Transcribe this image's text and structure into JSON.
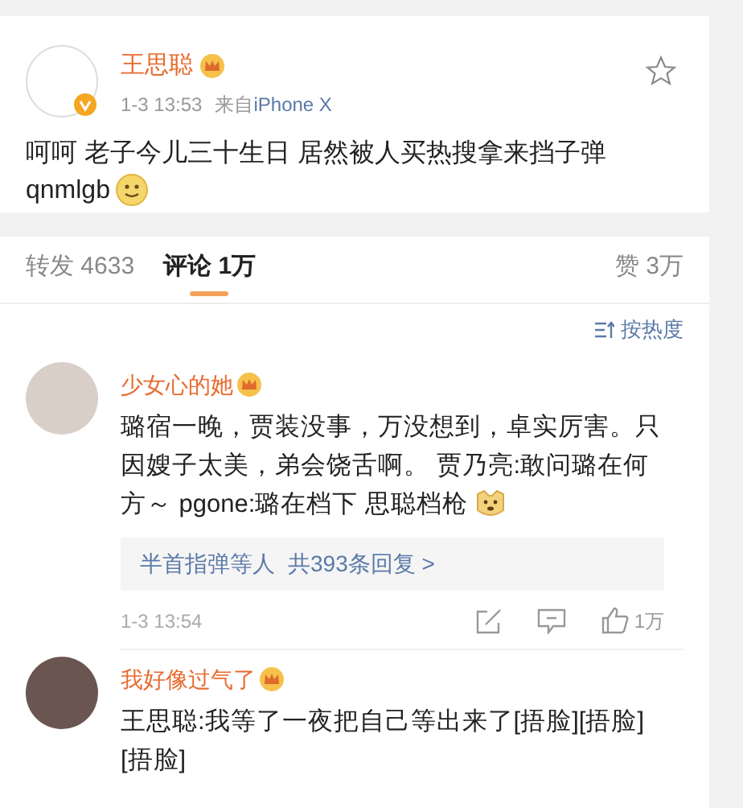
{
  "post": {
    "author": "王思聪",
    "time": "1-3 13:53",
    "source_prefix": "来自",
    "source": "iPhone X",
    "text": "呵呵 老子今儿三十生日 居然被人买热搜拿来挡子弹",
    "text_line2": "qnmlgb",
    "emoji": {
      "kind": "smile"
    },
    "verified": true,
    "starred": false
  },
  "tabs": [
    {
      "label": "转发",
      "count": "4633",
      "selected": false
    },
    {
      "label": "评论",
      "count": "1万",
      "selected": true
    }
  ],
  "likes": {
    "label": "赞",
    "count": "3万"
  },
  "sort": {
    "label": "按热度"
  },
  "comments": [
    {
      "author": "少女心的她",
      "text": "璐宿一晚，贾装没事，万没想到，卓实厉害。只因嫂子太美，弟会饶舌啊。 贾乃亮:敢问璐在何方～ pgone:璐在档下 思聪档枪",
      "emoji": {
        "kind": "dog"
      },
      "replies": {
        "names": "半首指弹等人",
        "count": "共393条回复 >"
      },
      "time": "1-3 13:54",
      "likes": "1万"
    },
    {
      "author": "我好像过气了",
      "text": "王思聪:我等了一夜把自己等出来了[捂脸][捂脸][捂脸]"
    }
  ]
}
